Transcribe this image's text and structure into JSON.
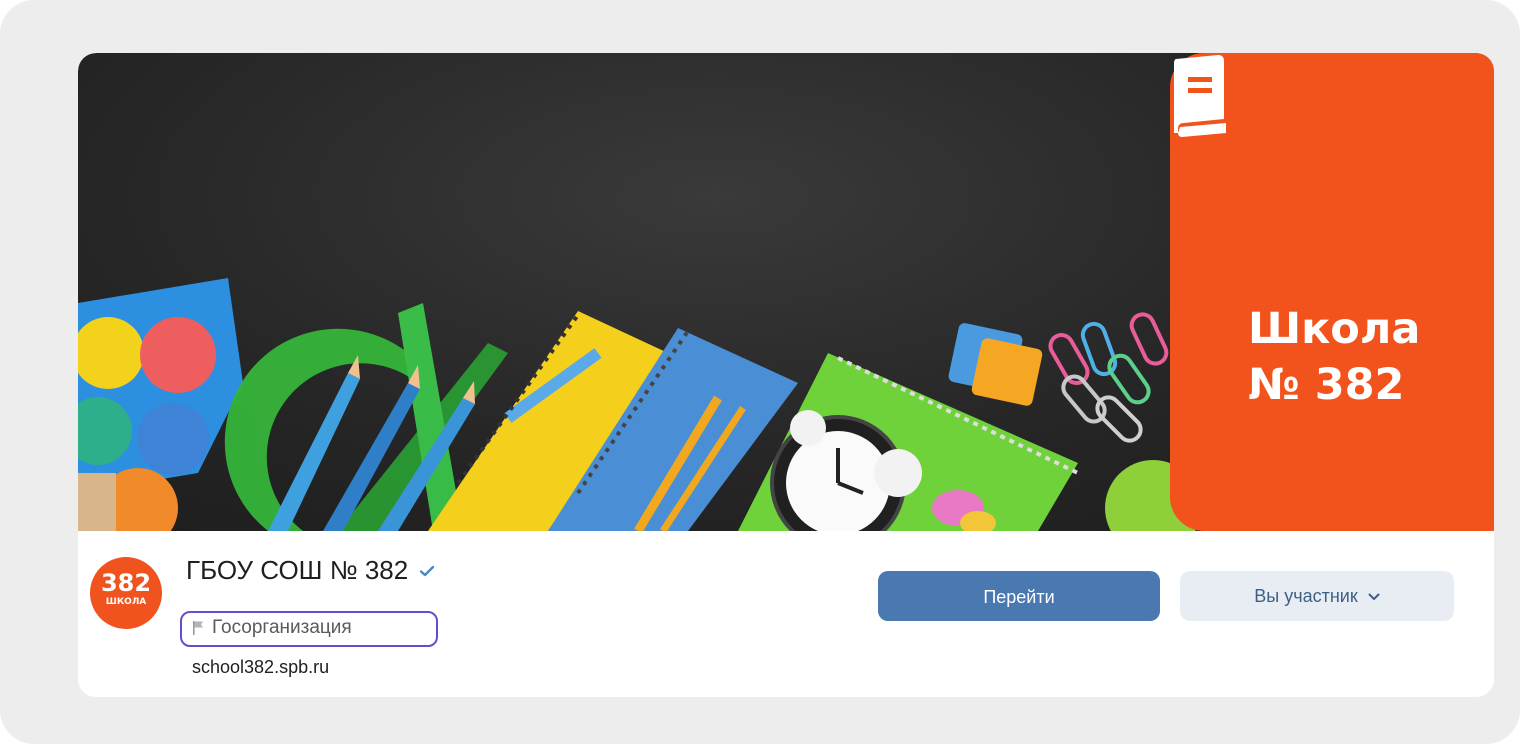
{
  "cover": {
    "brand_line1": "Школа",
    "brand_line2": "№ 382",
    "brand_color": "#f2521b",
    "brand_icon": "book-icon"
  },
  "avatar": {
    "number": "382",
    "caption": "ШКОЛА",
    "color": "#f0531d"
  },
  "group": {
    "name": "ГБОУ СОШ № 382",
    "verified_icon": "verified-check-icon",
    "category_icon": "flag-icon",
    "category": "Госорганизация",
    "site": "school382.spb.ru"
  },
  "actions": {
    "go_label": "Перейти",
    "member_label": "Вы участник",
    "member_icon": "chevron-down-icon",
    "go_color": "#4a78b0",
    "member_bg": "#e8edf3"
  },
  "highlight_color": "#6a4ad0"
}
